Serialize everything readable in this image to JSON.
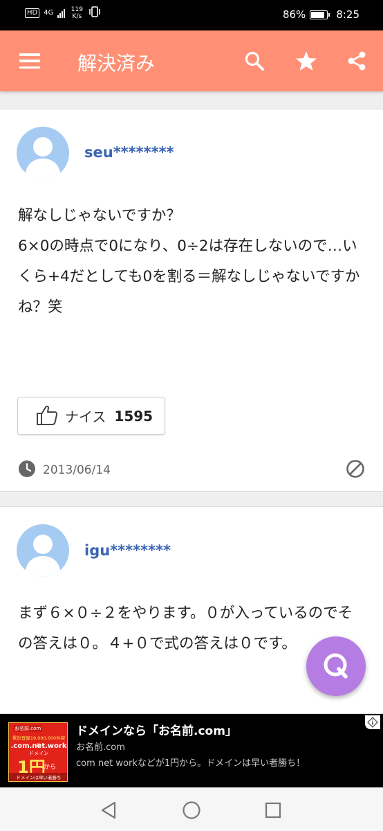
{
  "status_bar": {
    "hd": "HD",
    "network": "4G",
    "speed_value": "119",
    "speed_unit": "K/s",
    "battery": "86%",
    "battery_level": 0.86,
    "time": "8:25"
  },
  "app_bar": {
    "title": "解決済み",
    "icons": [
      "menu-icon",
      "search-icon",
      "star-icon",
      "share-icon"
    ]
  },
  "answers": [
    {
      "username": "seu********",
      "text": "解なしじゃないですか？\n6×0の時点で0になり、0÷2は存在しないので…いくら+4だとしても0を割る＝解なしじゃないですかね？笑",
      "nice_label": "ナイス",
      "nice_count": "1595",
      "date": "2013/06/14"
    },
    {
      "username": "igu********",
      "text": "まず６×０÷２をやります。０が入っているのでその答えは０。４+０で式の答えは０です。"
    }
  ],
  "fab": {
    "label": "Q"
  },
  "ad": {
    "image": {
      "logo": "お名前.com",
      "tagline": "累計登録19,000,000件突破",
      "domains": ".com.net.work",
      "domain_sub": "ドメイン",
      "price": "1円",
      "price_sub": "から",
      "footer": "ドメインは早い者勝ち"
    },
    "title": "ドメインなら「お名前.com」",
    "advertiser": "お名前.com",
    "description": "com net workなどが1円から。ドメインは早い者勝ち！"
  },
  "colors": {
    "app_bar": "#ff8f75",
    "username": "#3b64b4",
    "fab": "#b57de3",
    "avatar": "#a6cbf2"
  }
}
